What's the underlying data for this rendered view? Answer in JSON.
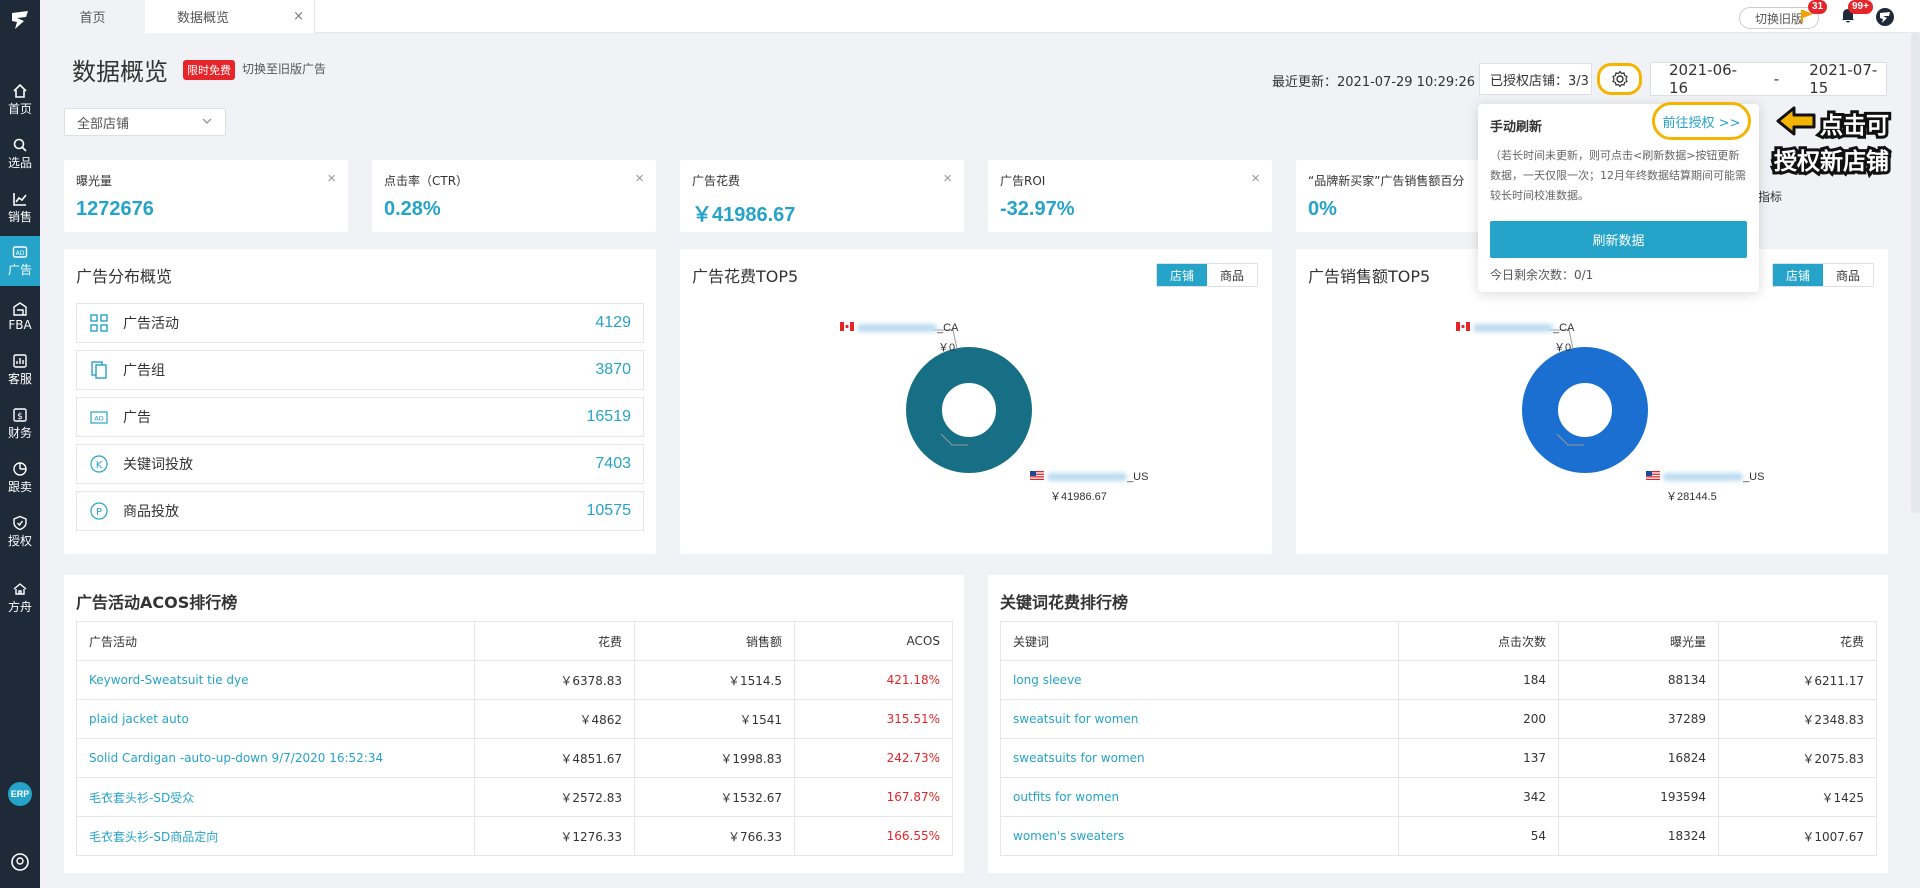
{
  "sidebar": {
    "items": [
      {
        "label": "首页",
        "icon": "home-icon"
      },
      {
        "label": "选品",
        "icon": "search-icon"
      },
      {
        "label": "销售",
        "icon": "chart-line-icon"
      },
      {
        "label": "广告",
        "icon": "ad-icon"
      },
      {
        "label": "FBA",
        "icon": "warehouse-icon"
      },
      {
        "label": "客服",
        "icon": "service-icon"
      },
      {
        "label": "财务",
        "icon": "finance-icon"
      },
      {
        "label": "跟卖",
        "icon": "pie-icon"
      },
      {
        "label": "授权",
        "icon": "shield-icon"
      },
      {
        "label": "方舟",
        "icon": "ark-icon"
      }
    ],
    "active": "广告",
    "erp": "ERP"
  },
  "tabs": {
    "home": "首页",
    "overview": "数据概览",
    "close": "×"
  },
  "topbar": {
    "switch_old": "切换旧版",
    "flag_count": "31",
    "bell_count": "99+"
  },
  "header": {
    "title": "数据概览",
    "promo_tag": "限时免费",
    "switch_link": "切换至旧版广告",
    "store_select": "全部店铺",
    "updated": "最近更新：2021-07-29 10:29:26",
    "authorized": "已授权店铺：3/3",
    "date_start": "2021-06-16",
    "date_sep": "-",
    "date_end": "2021-07-15"
  },
  "kpis": [
    {
      "label": "曝光量",
      "value": "1272676"
    },
    {
      "label": "点击率（CTR）",
      "value": "0.28%"
    },
    {
      "label": "广告花费",
      "value": "￥41986.67"
    },
    {
      "label": "广告ROI",
      "value": "-32.97%"
    },
    {
      "label": "“品牌新买家”广告销售额百分",
      "value": "0%"
    }
  ],
  "kpi_hidden_tail": "指标",
  "overview": {
    "title": "广告分布概览",
    "rows": [
      {
        "label": "广告活动",
        "value": "4129",
        "icon": "grid-icon"
      },
      {
        "label": "广告组",
        "value": "3870",
        "icon": "copy-icon"
      },
      {
        "label": "广告",
        "value": "16519",
        "icon": "ad-badge-icon"
      },
      {
        "label": "关键词投放",
        "value": "7403",
        "icon": "k-circle-icon"
      },
      {
        "label": "商品投放",
        "value": "10575",
        "icon": "p-circle-icon"
      }
    ]
  },
  "spend_top5": {
    "title": "广告花费TOP5",
    "toggle_store": "店铺",
    "toggle_product": "商品",
    "ca_suffix": "_CA",
    "ca_value": "￥0",
    "us_suffix": "_US",
    "us_value": "￥41986.67",
    "color": "#166f85"
  },
  "sales_top5": {
    "title": "广告销售额TOP5",
    "toggle_store": "店铺",
    "toggle_product": "商品",
    "ca_suffix": "_CA",
    "ca_value": "￥0",
    "us_suffix": "_US",
    "us_value": "￥28144.5",
    "color": "#1a6fd0"
  },
  "acos_table": {
    "title": "广告活动ACOS排行榜",
    "headers": [
      "广告活动",
      "花费",
      "销售额",
      "ACOS"
    ],
    "rows": [
      [
        "Keyword-Sweatsuit tie dye",
        "￥6378.83",
        "￥1514.5",
        "421.18%"
      ],
      [
        "plaid jacket auto",
        "￥4862",
        "￥1541",
        "315.51%"
      ],
      [
        "Solid Cardigan -auto-up-down 9/7/2020 16:52:34",
        "￥4851.67",
        "￥1998.83",
        "242.73%"
      ],
      [
        "毛衣套头衫-SD受众",
        "￥2572.83",
        "￥1532.67",
        "167.87%"
      ],
      [
        "毛衣套头衫-SD商品定向",
        "￥1276.33",
        "￥766.33",
        "166.55%"
      ]
    ]
  },
  "keyword_table": {
    "title": "关键词花费排行榜",
    "headers": [
      "关键词",
      "点击次数",
      "曝光量",
      "花费"
    ],
    "rows": [
      [
        "long sleeve",
        "184",
        "88134",
        "￥6211.17"
      ],
      [
        "sweatsuit for women",
        "200",
        "37289",
        "￥2348.83"
      ],
      [
        "sweatsuits for women",
        "137",
        "16824",
        "￥2075.83"
      ],
      [
        "outfits for women",
        "342",
        "193594",
        "￥1425"
      ],
      [
        "women's sweaters",
        "54",
        "18324",
        "￥1007.67"
      ]
    ]
  },
  "popup": {
    "title": "手动刷新",
    "link": "前往授权 >>",
    "text": "（若长时间未更新，则可点击<刷新数据>按钮更新数据，一天仅限一次；12月年终数据结算期间可能需较长时间校准数据。",
    "button": "刷新数据",
    "note": "今日剩余次数：0/1"
  },
  "annotation": {
    "line1": "点击可",
    "line2": "授权新店铺"
  }
}
